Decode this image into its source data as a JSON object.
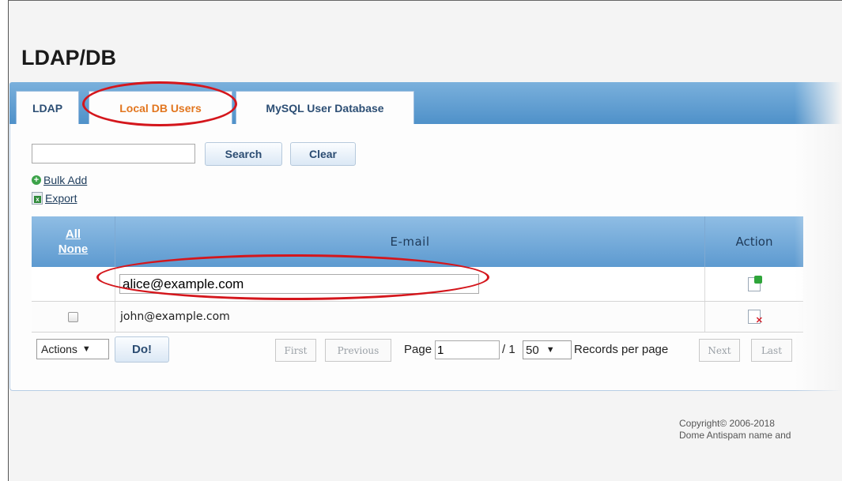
{
  "page": {
    "title": "LDAP/DB"
  },
  "tabs": [
    {
      "label": "LDAP"
    },
    {
      "label": "Local DB Users",
      "active": true
    },
    {
      "label": "MySQL User Database"
    }
  ],
  "toolbar": {
    "search_value": "",
    "search_label": "Search",
    "clear_label": "Clear",
    "bulk_add_label": "Bulk Add",
    "export_label": "Export"
  },
  "grid": {
    "select_all": "All",
    "select_none": "None",
    "col_email": "E-mail",
    "col_action": "Action",
    "new_email_value": "alice@example.com",
    "rows": [
      {
        "email": "john@example.com",
        "checked": false
      }
    ]
  },
  "footer": {
    "actions_label": "Actions",
    "do_label": "Do!",
    "first_label": "First",
    "previous_label": "Previous",
    "page_label": "Page",
    "page_value": "1",
    "page_total": "/ 1",
    "page_size": "50",
    "records_label": "Records per page",
    "next_label": "Next",
    "last_label": "Last"
  },
  "copyright": {
    "line1": "Copyright© 2006-2018",
    "line2": "Dome Antispam name and"
  },
  "colors": {
    "tab_active_text": "#e2761f",
    "header_blue": "#5d9ad0",
    "highlight_red": "#d4161c"
  }
}
